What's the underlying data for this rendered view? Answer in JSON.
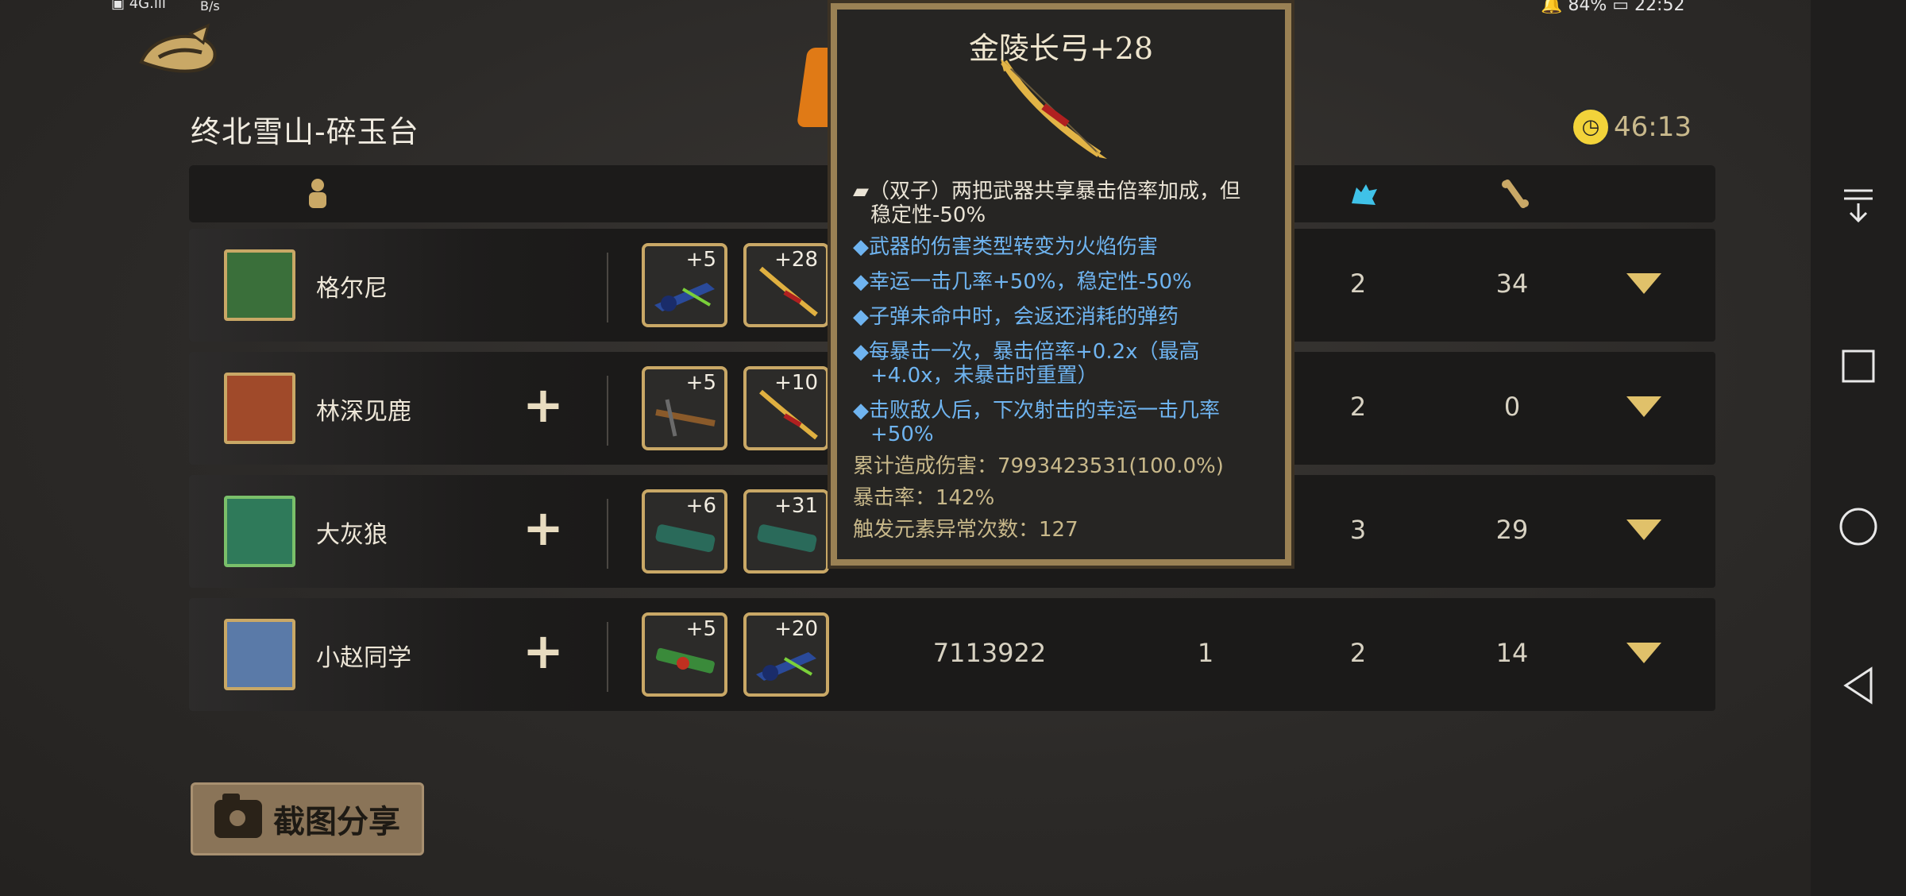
{
  "status_bar": {
    "left": "▣ 4G.ıll",
    "rate": "B/s",
    "right": "🔔 84%  ▭  22:52"
  },
  "level": {
    "title": "终北雪山-碎玉台",
    "timer": "46:13"
  },
  "header": {
    "icons": [
      "player-icon",
      "wolf-icon",
      "bone-icon"
    ]
  },
  "players": [
    {
      "name": "格尔尼",
      "has_plus": false,
      "weapons": [
        {
          "level": "+5"
        },
        {
          "level": "+28"
        }
      ],
      "col_a": "2",
      "col_b": "34",
      "avatar_color": "#3a6f3a"
    },
    {
      "name": "林深见鹿",
      "has_plus": true,
      "weapons": [
        {
          "level": "+5"
        },
        {
          "level": "+10"
        }
      ],
      "col_a": "2",
      "col_b": "0",
      "avatar_color": "#a04a2a"
    },
    {
      "name": "大灰狼",
      "has_plus": true,
      "weapons": [
        {
          "level": "+6"
        },
        {
          "level": "+31"
        }
      ],
      "col_a": "3",
      "col_b": "29",
      "avatar_color": "#2f7a5a"
    },
    {
      "name": "小赵同学",
      "has_plus": true,
      "weapons": [
        {
          "level": "+5"
        },
        {
          "level": "+20"
        }
      ],
      "damage": "7113922",
      "kills": "1",
      "col_a": "2",
      "col_b": "14",
      "avatar_color": "#5a7aa8"
    }
  ],
  "tooltip": {
    "title": "金陵长弓+28",
    "lines": [
      {
        "text": "▰（双子）两把武器共享暴击倍率加成，但",
        "style": "white"
      },
      {
        "text": "稳定性-50%",
        "style": "white"
      },
      {
        "text": "◆武器的伤害类型转变为火焰伤害",
        "style": "blue"
      },
      {
        "text": "◆幸运一击几率+50%，稳定性-50%",
        "style": "blue"
      },
      {
        "text": "◆子弹未命中时，会返还消耗的弹药",
        "style": "blue"
      },
      {
        "text": "◆每暴击一次，暴击倍率+0.2x（最高",
        "style": "blue"
      },
      {
        "text": "+4.0x，未暴击时重置）",
        "style": "blue"
      },
      {
        "text": "◆击败敌人后，下次射击的幸运一击几率",
        "style": "blue"
      },
      {
        "text": "+50%",
        "style": "blue"
      },
      {
        "text": "累计造成伤害：7993423531(100.0%)",
        "style": "stat"
      },
      {
        "text": "暴击率：142%",
        "style": "stat"
      },
      {
        "text": "触发元素异常次数：127",
        "style": "stat"
      }
    ]
  },
  "share_button": {
    "label": "截图分享"
  },
  "colors": {
    "accent_gold": "#c9a866",
    "tooltip_blue": "#6fb4f0",
    "timer_yellow": "#f2d33a"
  }
}
